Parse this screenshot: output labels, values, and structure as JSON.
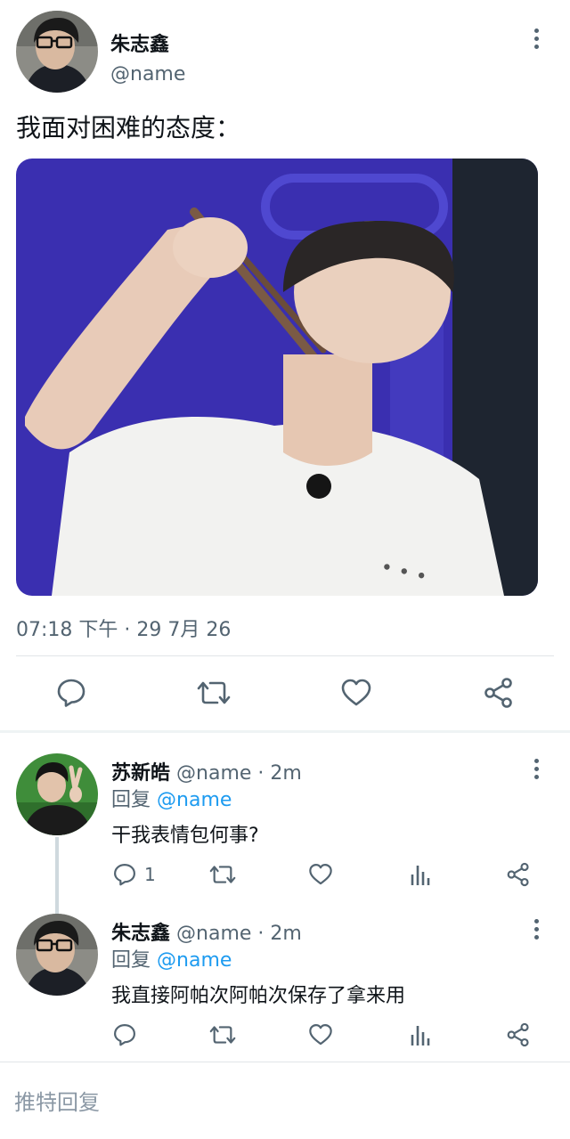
{
  "main_tweet": {
    "display_name": "朱志鑫",
    "handle": "@name",
    "text": "我面对困难的态度：",
    "timestamp": "07:18 下午 · 29 7月 26",
    "avatar_icon": "user-avatar-glasses",
    "media_icon": "photo-person-holding-chopsticks"
  },
  "replies": [
    {
      "display_name": "苏新皓",
      "handle": "@name",
      "time": "· 2m",
      "reply_prefix": "回复",
      "reply_to": "@name",
      "text": "干我表情包何事?",
      "reply_count": "1",
      "avatar_icon": "user-avatar-peace-sign"
    },
    {
      "display_name": "朱志鑫",
      "handle": "@name",
      "time": "· 2m",
      "reply_prefix": "回复",
      "reply_to": "@name",
      "text": "我直接阿帕次阿帕次保存了拿来用",
      "reply_count": "",
      "avatar_icon": "user-avatar-glasses"
    }
  ],
  "reply_input": {
    "placeholder": "推特回复"
  },
  "colors": {
    "accent": "#1d9bf0",
    "secondary_text": "#536471",
    "primary_text": "#0f1419",
    "media_background": "#3a2fb0"
  }
}
